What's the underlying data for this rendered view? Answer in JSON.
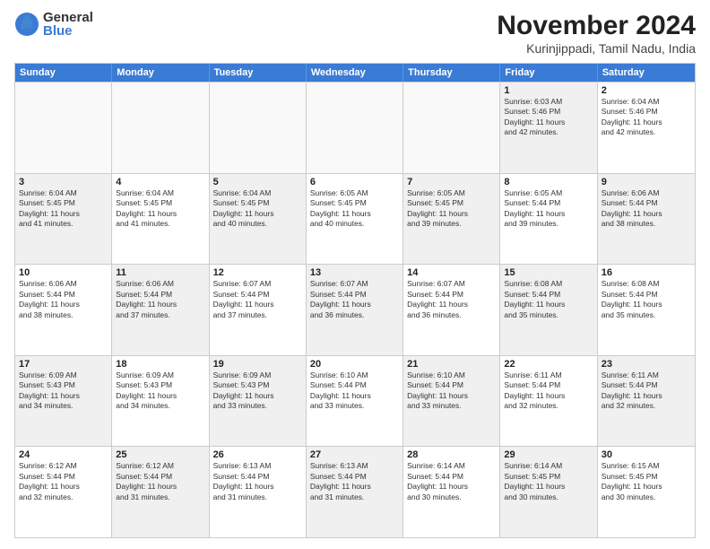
{
  "logo": {
    "general": "General",
    "blue": "Blue"
  },
  "title": "November 2024",
  "location": "Kurinjippadi, Tamil Nadu, India",
  "header": {
    "days": [
      "Sunday",
      "Monday",
      "Tuesday",
      "Wednesday",
      "Thursday",
      "Friday",
      "Saturday"
    ]
  },
  "weeks": [
    [
      {
        "num": "",
        "empty": true
      },
      {
        "num": "",
        "empty": true
      },
      {
        "num": "",
        "empty": true
      },
      {
        "num": "",
        "empty": true
      },
      {
        "num": "",
        "empty": true
      },
      {
        "num": "1",
        "info": "Sunrise: 6:03 AM\nSunset: 5:46 PM\nDaylight: 11 hours\nand 42 minutes.",
        "shaded": true
      },
      {
        "num": "2",
        "info": "Sunrise: 6:04 AM\nSunset: 5:46 PM\nDaylight: 11 hours\nand 42 minutes.",
        "shaded": false
      }
    ],
    [
      {
        "num": "3",
        "info": "Sunrise: 6:04 AM\nSunset: 5:45 PM\nDaylight: 11 hours\nand 41 minutes.",
        "shaded": true
      },
      {
        "num": "4",
        "info": "Sunrise: 6:04 AM\nSunset: 5:45 PM\nDaylight: 11 hours\nand 41 minutes.",
        "shaded": false
      },
      {
        "num": "5",
        "info": "Sunrise: 6:04 AM\nSunset: 5:45 PM\nDaylight: 11 hours\nand 40 minutes.",
        "shaded": true
      },
      {
        "num": "6",
        "info": "Sunrise: 6:05 AM\nSunset: 5:45 PM\nDaylight: 11 hours\nand 40 minutes.",
        "shaded": false
      },
      {
        "num": "7",
        "info": "Sunrise: 6:05 AM\nSunset: 5:45 PM\nDaylight: 11 hours\nand 39 minutes.",
        "shaded": true
      },
      {
        "num": "8",
        "info": "Sunrise: 6:05 AM\nSunset: 5:44 PM\nDaylight: 11 hours\nand 39 minutes.",
        "shaded": false
      },
      {
        "num": "9",
        "info": "Sunrise: 6:06 AM\nSunset: 5:44 PM\nDaylight: 11 hours\nand 38 minutes.",
        "shaded": true
      }
    ],
    [
      {
        "num": "10",
        "info": "Sunrise: 6:06 AM\nSunset: 5:44 PM\nDaylight: 11 hours\nand 38 minutes.",
        "shaded": false
      },
      {
        "num": "11",
        "info": "Sunrise: 6:06 AM\nSunset: 5:44 PM\nDaylight: 11 hours\nand 37 minutes.",
        "shaded": true
      },
      {
        "num": "12",
        "info": "Sunrise: 6:07 AM\nSunset: 5:44 PM\nDaylight: 11 hours\nand 37 minutes.",
        "shaded": false
      },
      {
        "num": "13",
        "info": "Sunrise: 6:07 AM\nSunset: 5:44 PM\nDaylight: 11 hours\nand 36 minutes.",
        "shaded": true
      },
      {
        "num": "14",
        "info": "Sunrise: 6:07 AM\nSunset: 5:44 PM\nDaylight: 11 hours\nand 36 minutes.",
        "shaded": false
      },
      {
        "num": "15",
        "info": "Sunrise: 6:08 AM\nSunset: 5:44 PM\nDaylight: 11 hours\nand 35 minutes.",
        "shaded": true
      },
      {
        "num": "16",
        "info": "Sunrise: 6:08 AM\nSunset: 5:44 PM\nDaylight: 11 hours\nand 35 minutes.",
        "shaded": false
      }
    ],
    [
      {
        "num": "17",
        "info": "Sunrise: 6:09 AM\nSunset: 5:43 PM\nDaylight: 11 hours\nand 34 minutes.",
        "shaded": true
      },
      {
        "num": "18",
        "info": "Sunrise: 6:09 AM\nSunset: 5:43 PM\nDaylight: 11 hours\nand 34 minutes.",
        "shaded": false
      },
      {
        "num": "19",
        "info": "Sunrise: 6:09 AM\nSunset: 5:43 PM\nDaylight: 11 hours\nand 33 minutes.",
        "shaded": true
      },
      {
        "num": "20",
        "info": "Sunrise: 6:10 AM\nSunset: 5:44 PM\nDaylight: 11 hours\nand 33 minutes.",
        "shaded": false
      },
      {
        "num": "21",
        "info": "Sunrise: 6:10 AM\nSunset: 5:44 PM\nDaylight: 11 hours\nand 33 minutes.",
        "shaded": true
      },
      {
        "num": "22",
        "info": "Sunrise: 6:11 AM\nSunset: 5:44 PM\nDaylight: 11 hours\nand 32 minutes.",
        "shaded": false
      },
      {
        "num": "23",
        "info": "Sunrise: 6:11 AM\nSunset: 5:44 PM\nDaylight: 11 hours\nand 32 minutes.",
        "shaded": true
      }
    ],
    [
      {
        "num": "24",
        "info": "Sunrise: 6:12 AM\nSunset: 5:44 PM\nDaylight: 11 hours\nand 32 minutes.",
        "shaded": false
      },
      {
        "num": "25",
        "info": "Sunrise: 6:12 AM\nSunset: 5:44 PM\nDaylight: 11 hours\nand 31 minutes.",
        "shaded": true
      },
      {
        "num": "26",
        "info": "Sunrise: 6:13 AM\nSunset: 5:44 PM\nDaylight: 11 hours\nand 31 minutes.",
        "shaded": false
      },
      {
        "num": "27",
        "info": "Sunrise: 6:13 AM\nSunset: 5:44 PM\nDaylight: 11 hours\nand 31 minutes.",
        "shaded": true
      },
      {
        "num": "28",
        "info": "Sunrise: 6:14 AM\nSunset: 5:44 PM\nDaylight: 11 hours\nand 30 minutes.",
        "shaded": false
      },
      {
        "num": "29",
        "info": "Sunrise: 6:14 AM\nSunset: 5:45 PM\nDaylight: 11 hours\nand 30 minutes.",
        "shaded": true
      },
      {
        "num": "30",
        "info": "Sunrise: 6:15 AM\nSunset: 5:45 PM\nDaylight: 11 hours\nand 30 minutes.",
        "shaded": false
      }
    ]
  ]
}
